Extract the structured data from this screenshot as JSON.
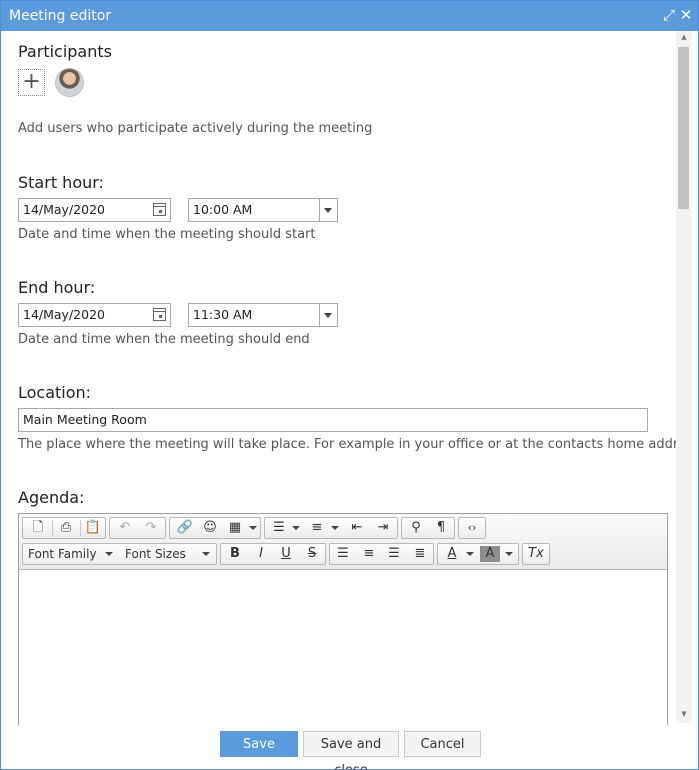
{
  "window": {
    "title": "Meeting editor"
  },
  "icons": {
    "maximize": "expand-icon",
    "close": "close-icon"
  },
  "participants": {
    "label": "Participants",
    "add_symbol": "+",
    "hint": "Add users who participate actively during the meeting"
  },
  "start": {
    "label": "Start hour:",
    "date": "14/May/2020",
    "time": "10:00 AM",
    "hint": "Date and time when the meeting should start"
  },
  "end": {
    "label": "End hour:",
    "date": "14/May/2020",
    "time": "11:30 AM",
    "hint": "Date and time when the meeting should end"
  },
  "location": {
    "label": "Location:",
    "value": "Main Meeting Room",
    "hint": "The place where the meeting will take place. For example in your office or at the contacts home address"
  },
  "agenda": {
    "label": "Agenda:",
    "font_family": "Font Family",
    "font_sizes": "Font Sizes",
    "glyphs": {
      "new": "🗋",
      "print": "⎙",
      "paste": "📋",
      "undo": "↶",
      "redo": "↷",
      "link": "🔗",
      "emoticons": "☺",
      "table": "▦",
      "bullet_list": "☰",
      "num_list": "≡",
      "outdent": "⇤",
      "indent": "⇥",
      "find": "⚲",
      "paragraph": "¶",
      "code": "‹›",
      "bold": "B",
      "italic": "I",
      "underline": "U",
      "strike": "S",
      "align_left": "☰",
      "align_center": "≡",
      "align_right": "☰",
      "justify": "≣",
      "text_color": "A",
      "bg_color": "A",
      "clear_format": "Tx"
    }
  },
  "footer": {
    "save": "Save",
    "save_close": "Save and close",
    "cancel": "Cancel"
  },
  "colors": {
    "accent": "#5b9bdc"
  }
}
